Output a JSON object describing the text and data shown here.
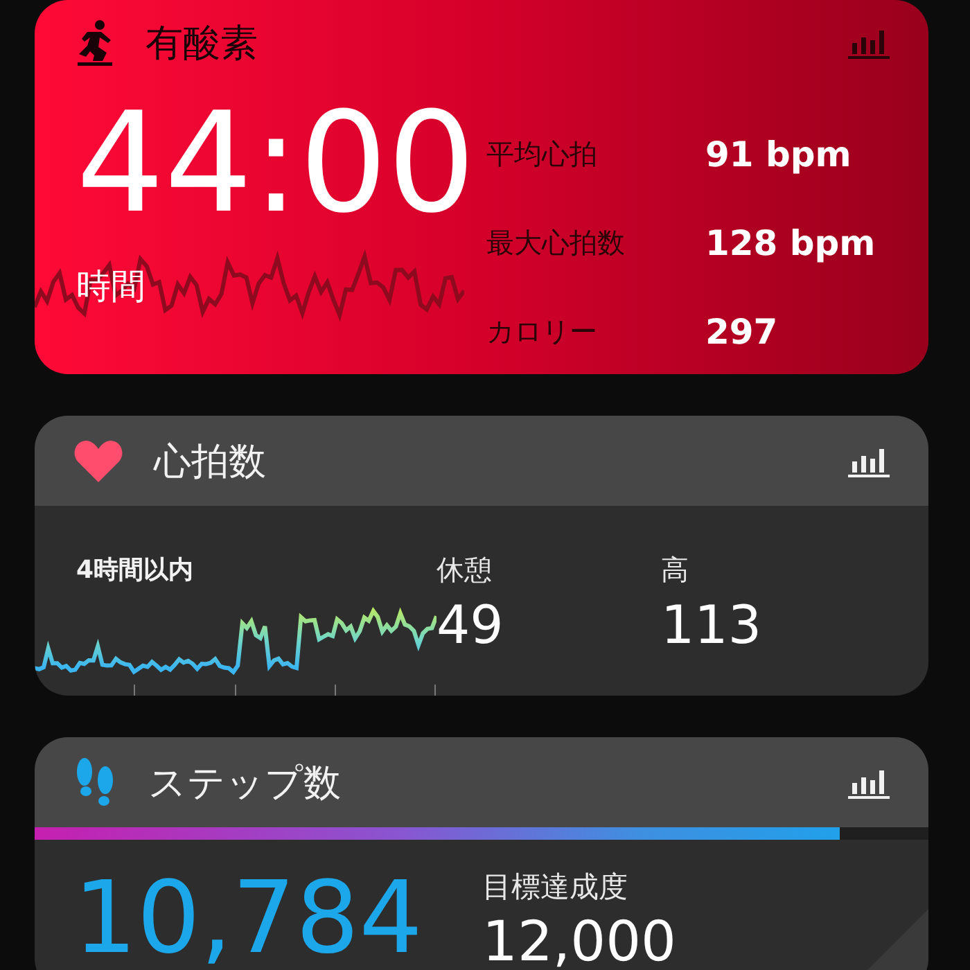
{
  "aerobic": {
    "title": "有酸素",
    "time": "44:00",
    "time_label": "時間",
    "stats": [
      {
        "label": "平均心拍",
        "value": "91 bpm"
      },
      {
        "label": "最大心拍数",
        "value": "128 bpm"
      },
      {
        "label": "カロリー",
        "value": "297"
      }
    ]
  },
  "heart_rate": {
    "title": "心拍数",
    "period": "4時間以内",
    "stats": [
      {
        "label": "休憩",
        "value": "49"
      },
      {
        "label": "高",
        "value": "113"
      }
    ]
  },
  "steps": {
    "title": "ステップ数",
    "progress": {
      "level": 0.9
    },
    "count": "10,784",
    "goal_label": "目標達成度",
    "goal": "12,000"
  }
}
